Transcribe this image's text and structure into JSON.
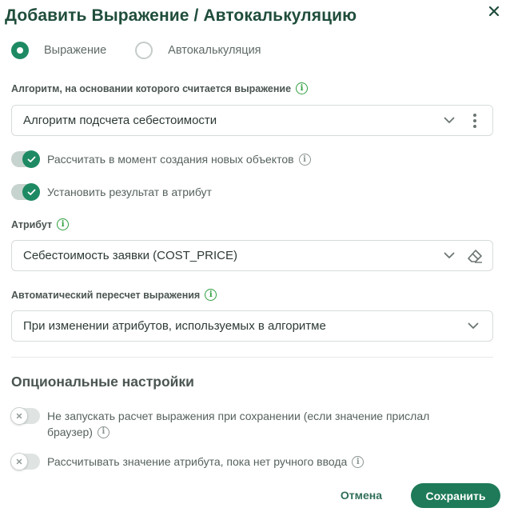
{
  "dialog": {
    "title": "Добавить Выражение / Автокалькуляцию",
    "close_icon": "close-icon"
  },
  "mode": {
    "options": [
      {
        "label": "Выражение",
        "checked": true
      },
      {
        "label": "Автокалькуляция",
        "checked": false
      }
    ]
  },
  "algorithm": {
    "label": "Алгоритм, на основании которого считается выражение",
    "value": "Алгоритм подсчета себестоимости"
  },
  "toggles": {
    "calc_on_create": {
      "label": "Рассчитать в момент создания новых объектов",
      "on": true
    },
    "set_result": {
      "label": "Установить результат в атрибут",
      "on": true
    }
  },
  "attribute": {
    "label": "Атрибут",
    "value": "Себестоимость заявки (COST_PRICE)"
  },
  "recalc": {
    "label": "Автоматический пересчет выражения",
    "value": "При изменении атрибутов, используемых в алгоритме"
  },
  "optional": {
    "title": "Опциональные настройки",
    "no_run_on_save": {
      "label_line1": "Не запускать расчет выражения при сохранении (если значение прислал",
      "label_line2": "браузер)",
      "on": false
    },
    "calc_until_manual": {
      "label": "Рассчитывать значение атрибута, пока нет ручного ввода",
      "on": false
    }
  },
  "footer": {
    "cancel_label": "Отмена",
    "save_label": "Сохранить"
  },
  "colors": {
    "accent": "#1e8a63",
    "title": "#1f4d3b",
    "info": "#2e9e3f"
  }
}
